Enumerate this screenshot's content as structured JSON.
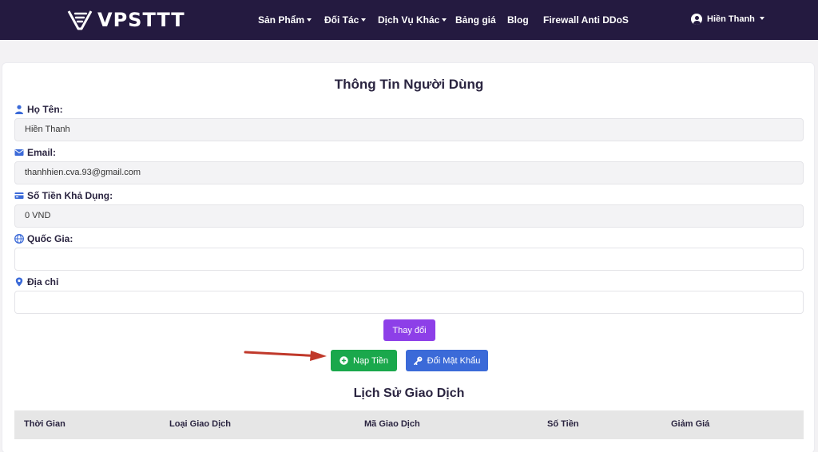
{
  "brand": {
    "name": "VPSTTT"
  },
  "nav": {
    "items": [
      {
        "label": "Sản Phẩm",
        "dropdown": true
      },
      {
        "label": "Đối Tác",
        "dropdown": true
      },
      {
        "label": "Dịch Vụ Khác",
        "dropdown": true
      },
      {
        "label": "Bảng giá",
        "dropdown": false
      },
      {
        "label": "Blog",
        "dropdown": false
      },
      {
        "label": "Firewall Anti DDoS",
        "dropdown": false
      }
    ],
    "user": {
      "name": "Hiền Thanh"
    }
  },
  "profile": {
    "title": "Thông Tin Người Dùng",
    "fields": [
      {
        "label": "Họ Tên:",
        "value": "Hiền Thanh",
        "icon": "user-icon",
        "readonly": true
      },
      {
        "label": "Email:",
        "value": "thanhhien.cva.93@gmail.com",
        "icon": "envelope-icon",
        "readonly": true
      },
      {
        "label": "Số Tiền Khả Dụng:",
        "value": "0 VND",
        "icon": "money-icon",
        "readonly": true
      },
      {
        "label": "Quốc Gia:",
        "value": "",
        "icon": "globe-icon",
        "readonly": false
      },
      {
        "label": "Địa chỉ",
        "value": "",
        "icon": "map-pin-icon",
        "readonly": false
      }
    ],
    "buttons": {
      "change": "Thay đổi",
      "topup": "Nạp Tiền",
      "change_password": "Đổi Mật Khẩu"
    }
  },
  "history": {
    "title": "Lịch Sử Giao Dịch",
    "columns": [
      "Thời Gian",
      "Loại Giao Dịch",
      "Mã Giao Dịch",
      "Số Tiền",
      "Giảm Giá"
    ]
  },
  "colors": {
    "header_bg": "#241a40",
    "accent_purple": "#8d3fe8",
    "success_green": "#1aa84c",
    "primary_blue": "#3b6ad8",
    "annotation_arrow": "#c0392b"
  }
}
